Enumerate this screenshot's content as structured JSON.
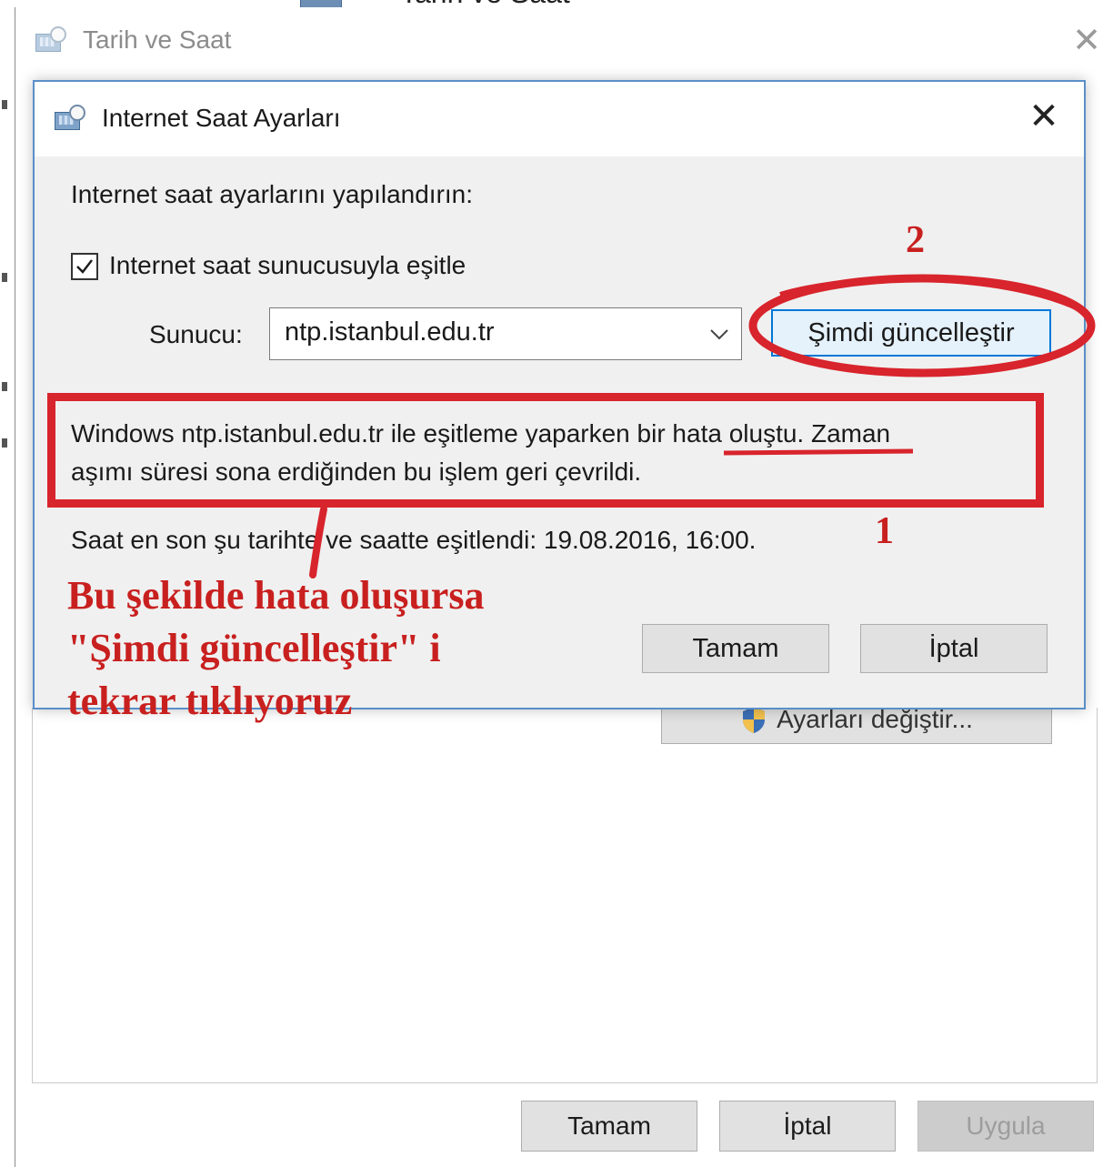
{
  "background_window": {
    "partial_title": "Tarih ve Saat"
  },
  "parent_window": {
    "title": "Tarih ve Saat",
    "change_settings_label": "Ayarları değiştir...",
    "ok_label": "Tamam",
    "cancel_label": "İptal",
    "apply_label": "Uygula"
  },
  "dialog": {
    "title": "Internet Saat Ayarları",
    "heading": "Internet saat ayarlarını yapılandırın:",
    "sync_checkbox_label": "Internet saat sunucusuyla eşitle",
    "sync_checked": true,
    "server_label": "Sunucu:",
    "server_value": "ntp.istanbul.edu.tr",
    "update_now_label": "Şimdi güncelleştir",
    "error_line1": "Windows ntp.istanbul.edu.tr ile eşitleme yaparken bir hata oluştu.  Zaman",
    "error_line2": "aşımı süresi sona erdiğinden bu işlem geri çevrildi.",
    "last_sync_text": "Saat en son şu tarihte ve saatte eşitlendi: 19.08.2016, 16:00.",
    "ok_label": "Tamam",
    "cancel_label": "İptal"
  },
  "annotations": {
    "color": "#d8242c",
    "marker_1": "1",
    "marker_2": "2",
    "note_line1": "Bu şekilde hata oluşursa",
    "note_line2": "\"Şimdi güncelleştir\" i",
    "note_line3": "tekrar tıklıyoruz"
  },
  "colors": {
    "dialog_border": "#5a8fc8",
    "focus_border": "#0078d7",
    "button_face": "#e1e1e1"
  }
}
